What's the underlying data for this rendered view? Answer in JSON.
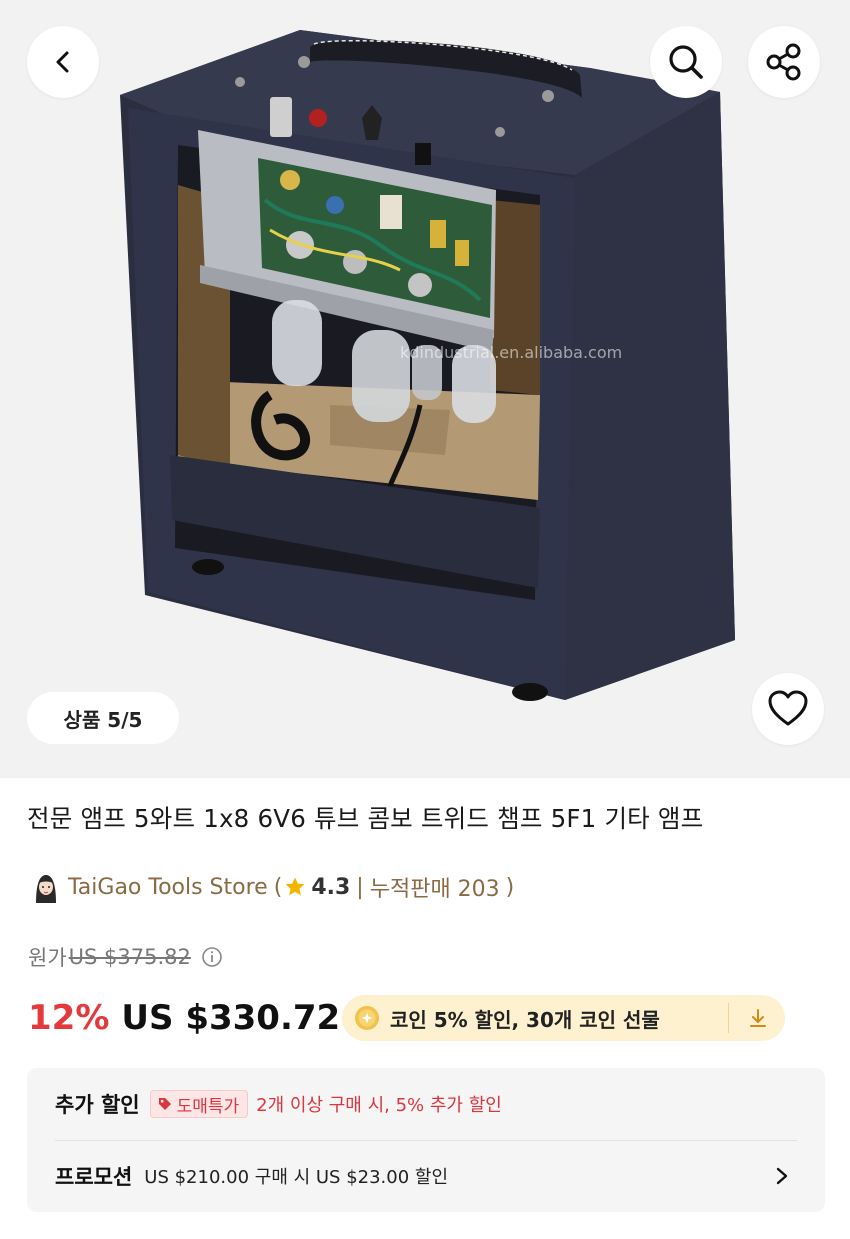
{
  "hero": {
    "image_counter": {
      "label": "상품",
      "current": "5",
      "total": "5",
      "display": "상품 5/5"
    },
    "watermark": "kdindustrial.en.alibaba.com",
    "icons": {
      "back": "chevron-left-icon",
      "search": "search-icon",
      "share": "share-icon",
      "favorite": "heart-icon"
    }
  },
  "product": {
    "title": "전문 앰프 5와트 1x8 6V6 튜브 콤보 트위드 챔프 5F1 기타 앰프",
    "store": {
      "name": "TaiGao Tools Store",
      "open_paren": "(",
      "rating": "4.3",
      "separator": "|",
      "sales": "누적판매 203",
      "close_paren": ")"
    },
    "original_price": {
      "label": "원가",
      "value": "US $375.82"
    },
    "discount": "12%",
    "price": "US $330.72",
    "coin_offer": "코인 5% 할인,  30개 코인 선물"
  },
  "extra": {
    "label": "추가 할인",
    "tag": "도매특가",
    "text": "2개 이상 구매 시, 5% 추가 할인"
  },
  "promotion": {
    "label": "프로모션",
    "text": "US $210.00 구매 시 US $23.00 할인"
  },
  "colors": {
    "discount_red": "#e4393c",
    "store_brown": "#8a6a45",
    "coin_bg": "#fdf1cf",
    "tag_red": "#d9363e",
    "card_bg": "#f5f5f5"
  }
}
